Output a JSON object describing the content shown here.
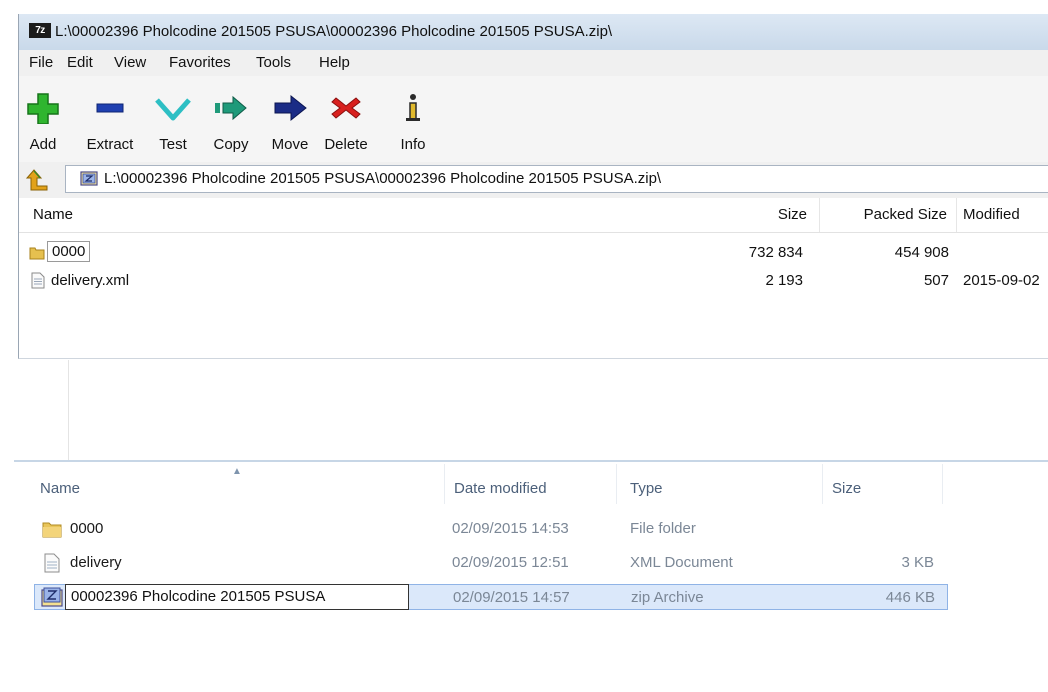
{
  "zip_window": {
    "title_icon": "7z",
    "title": "L:\\00002396 Pholcodine 201505 PSUSA\\00002396 Pholcodine 201505 PSUSA.zip\\",
    "menu": [
      "File",
      "Edit",
      "View",
      "Favorites",
      "Tools",
      "Help"
    ],
    "toolbar": [
      {
        "label": "Add",
        "icon": "add-icon"
      },
      {
        "label": "Extract",
        "icon": "extract-icon"
      },
      {
        "label": "Test",
        "icon": "test-icon"
      },
      {
        "label": "Copy",
        "icon": "copy-icon"
      },
      {
        "label": "Move",
        "icon": "move-icon"
      },
      {
        "label": "Delete",
        "icon": "delete-icon"
      },
      {
        "label": "Info",
        "icon": "info-icon"
      }
    ],
    "address": "L:\\00002396 Pholcodine 201505 PSUSA\\00002396 Pholcodine 201505 PSUSA.zip\\",
    "columns": {
      "name": "Name",
      "size": "Size",
      "packed": "Packed Size",
      "modified": "Modified"
    },
    "rows": [
      {
        "name": "0000",
        "size": "732 834",
        "packed": "454 908",
        "modified": "",
        "type": "folder"
      },
      {
        "name": "delivery.xml",
        "size": "2 193",
        "packed": "507",
        "modified": "2015-09-02",
        "type": "file"
      }
    ]
  },
  "explorer": {
    "columns": {
      "name": "Name",
      "date": "Date modified",
      "type": "Type",
      "size": "Size"
    },
    "rows": [
      {
        "name": "0000",
        "date": "02/09/2015 14:53",
        "type": "File folder",
        "size": "",
        "kind": "folder"
      },
      {
        "name": "delivery",
        "date": "02/09/2015 12:51",
        "type": "XML Document",
        "size": "3 KB",
        "kind": "file"
      },
      {
        "name": "00002396 Pholcodine 201505 PSUSA",
        "date": "02/09/2015 14:57",
        "type": "zip Archive",
        "size": "446 KB",
        "kind": "zip",
        "renaming": true
      }
    ]
  },
  "colors": {
    "selection": "#dbe8fa",
    "selection_border": "#8fb3e6",
    "header_text": "#4c607a"
  }
}
